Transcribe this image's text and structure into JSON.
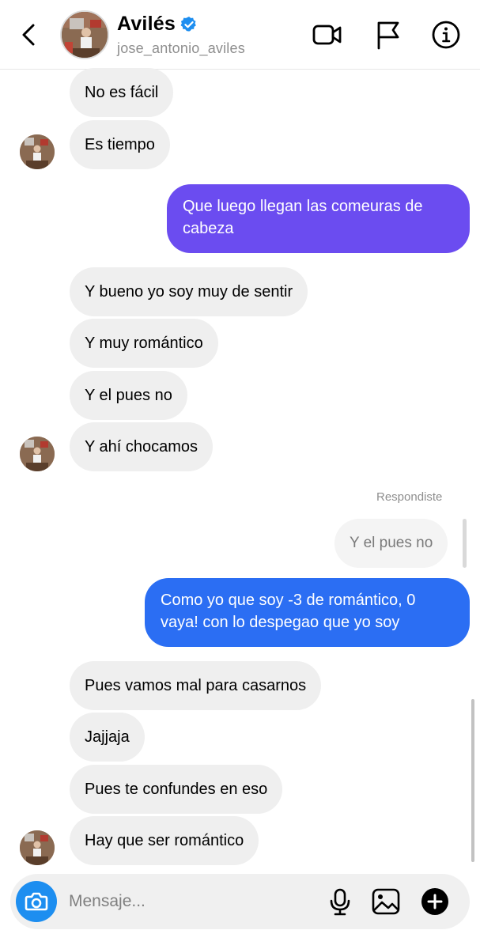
{
  "header": {
    "name": "Avilés",
    "username": "jose_antonio_aviles"
  },
  "thread": {
    "group1": [
      "No es fácil",
      "Es tiempo"
    ],
    "sent1": "Que luego llegan las comeuras de cabeza",
    "group2": [
      "Y bueno yo soy muy de sentir",
      "Y muy romántico",
      "Y el pues no",
      "Y ahí chocamos"
    ],
    "replied_label": "Respondiste",
    "quoted": "Y el pues no",
    "sent2": "Como yo que soy -3 de romántico, 0 vaya! con lo despegao que yo soy",
    "group3": [
      "Pues vamos mal para casarnos",
      "Jajjaja",
      "Pues te confundes en eso",
      "Hay que ser romántico"
    ]
  },
  "composer": {
    "placeholder": "Mensaje..."
  },
  "colors": {
    "sent_purple": "#6b4cf0",
    "sent_blue": "#2b6ef3",
    "received_bg": "#efefef",
    "camera_button": "#1d8ef0",
    "verified_badge": "#1d8ef0"
  },
  "icons": [
    "back-arrow-icon",
    "verified-badge-icon",
    "video-call-icon",
    "flag-icon",
    "info-icon",
    "camera-icon",
    "microphone-icon",
    "gallery-icon",
    "plus-icon"
  ]
}
